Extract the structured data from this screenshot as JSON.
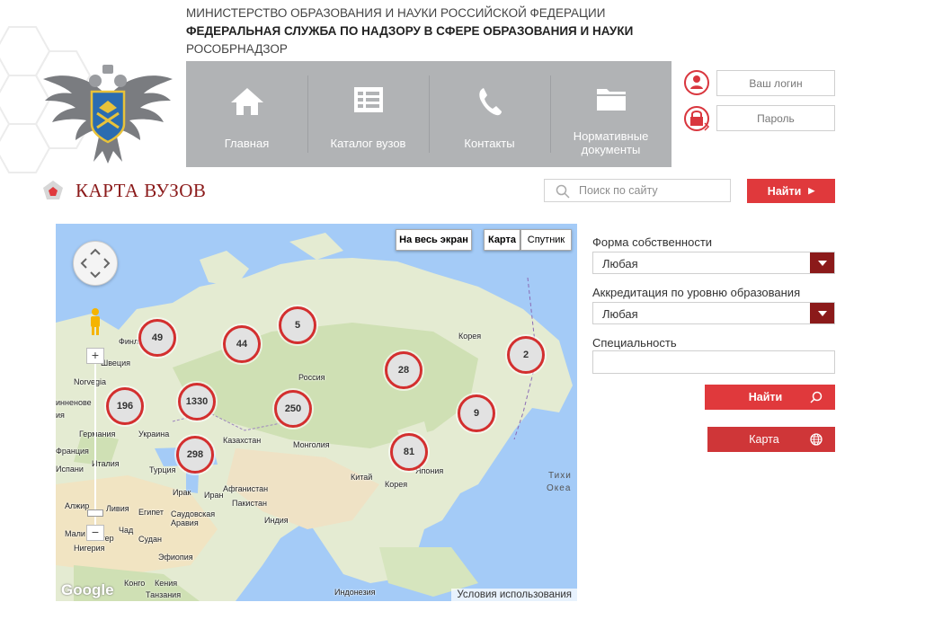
{
  "header": {
    "line1": "МИНИСТЕРСТВО ОБРАЗОВАНИЯ И НАУКИ РОССИЙСКОЙ ФЕДЕРАЦИИ",
    "line2": "ФЕДЕРАЛЬНАЯ СЛУЖБА ПО НАДЗОРУ В СФЕРЕ ОБРАЗОВАНИЯ И НАУКИ",
    "line3": "РОСОБРНАДЗОР"
  },
  "nav": {
    "items": [
      {
        "label": "Главная",
        "icon": "home-icon"
      },
      {
        "label": "Каталог вузов",
        "icon": "catalog-icon"
      },
      {
        "label": "Контакты",
        "icon": "phone-icon"
      },
      {
        "label": "Нормативные документы",
        "icon": "folder-icon"
      }
    ]
  },
  "auth": {
    "login_placeholder": "Ваш логин",
    "password_placeholder": "Пароль"
  },
  "page": {
    "title": "КАРТА ВУЗОВ"
  },
  "search": {
    "placeholder": "Поиск по сайту",
    "button_label": "Найти"
  },
  "map": {
    "fullscreen_label": "На весь экран",
    "type_map_label": "Карта",
    "type_satellite_label": "Спутник",
    "google_label": "Google",
    "terms_label": "Условия использования",
    "ocean_label_1": "Тихи",
    "ocean_label_2": "Океа",
    "clusters": [
      {
        "count": "49"
      },
      {
        "count": "44"
      },
      {
        "count": "5"
      },
      {
        "count": "28"
      },
      {
        "count": "2"
      },
      {
        "count": "196"
      },
      {
        "count": "1330"
      },
      {
        "count": "250"
      },
      {
        "count": "9"
      },
      {
        "count": "298"
      },
      {
        "count": "81"
      }
    ],
    "places": [
      "Финля",
      "Швеция",
      "Norvegia",
      "Россия",
      "инненове",
      "ия",
      "Германия",
      "Франция",
      "Украина",
      "Казахстан",
      "Монголия",
      "Турция",
      "Ирак",
      "Иран",
      "Афганистан",
      "Китай",
      "Корея",
      "Япония",
      "Пакистан",
      "Индия",
      "Саудовская Аравия",
      "Алжир",
      "Ливия",
      "Египет",
      "Мали",
      "Нигер",
      "Чад",
      "Судан",
      "Нигерия",
      "Эфиопия",
      "Конго",
      "Кения",
      "Танзания",
      "Индонезия",
      "Испани",
      "Италия",
      "Корея"
    ]
  },
  "filters": {
    "ownership_label": "Форма собственности",
    "ownership_value": "Любая",
    "accreditation_label": "Аккредитация по уровню образования",
    "accreditation_value": "Любая",
    "specialty_label": "Специальность",
    "specialty_value": "",
    "find_button_label": "Найти",
    "map_button_label": "Карта"
  },
  "colors": {
    "accent_red": "#e0393c",
    "dark_red": "#8b1a1a",
    "nav_gray": "#b1b3b5"
  }
}
